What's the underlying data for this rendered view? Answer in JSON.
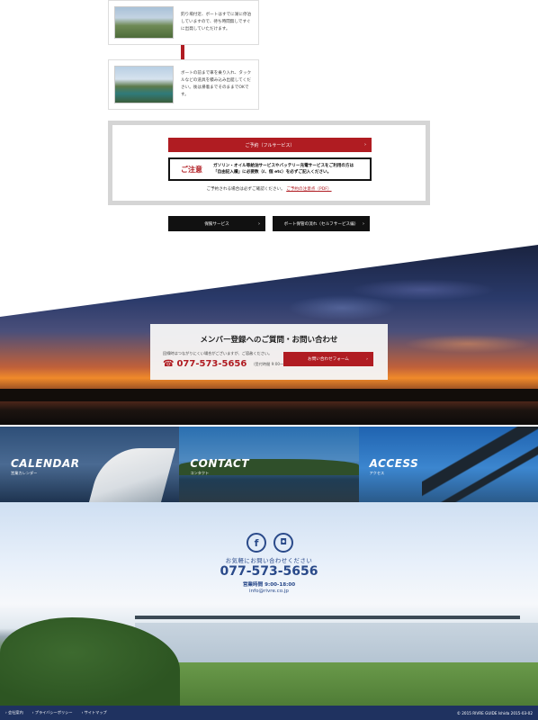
{
  "steps": [
    {
      "text": "釣り場付近、ボートはすでに湖に停泊していますので、待ち時間無しですぐに出発していただけます。"
    },
    {
      "text": "ボートの前まで車を乗り入れ、タックルなどの道具を積み込み出艇してください。後は帰着までそのままでOKです。"
    }
  ],
  "reservation": {
    "button_label": "ご予約（フルサービス）",
    "arrow": "›",
    "notice_label": "ご注意",
    "notice_line1": "ガソリン・オイル等給油サービスやバッテリー充電サービスをご利用の方は",
    "notice_line2": "「自由記入欄」に必要数（ℓ、個 etc）を必ずご記入ください。",
    "confirm_text": "ご予約される場合は必ずご確認ください。",
    "confirm_link": "ご予約の注意点（PDF）"
  },
  "service_buttons": [
    {
      "label": "保険サービス",
      "arrow": "›"
    },
    {
      "label": "ボート保管の流れ（セルフサービス編）",
      "arrow": "›"
    }
  ],
  "contact_card": {
    "title": "メンバー登録へのご質問・お問い合わせ",
    "subtitle": "回線時はつながりにくい場合がございますが、ご容赦ください。",
    "phone": "077-573-5656",
    "hours": "（受付時間 9:00～18:00）",
    "button_label": "お問い合わせフォーム",
    "arrow": "›"
  },
  "panels": [
    {
      "title": "CALENDAR",
      "subtitle": "営業カレンダー"
    },
    {
      "title": "CONTACT",
      "subtitle": "コンタクト"
    },
    {
      "title": "ACCESS",
      "subtitle": "アクセス"
    }
  ],
  "footer_contact": {
    "facebook_glyph": "f",
    "instagram_glyph": "◘",
    "invite": "お気軽にお問い合わせください",
    "phone": "077-573-5656",
    "hours": "営業時間 9:00-18:00",
    "email": "info@rivre.co.jp"
  },
  "footer_bar": {
    "links": [
      "会社案内",
      "プライバシーポリシー",
      "サイトマップ"
    ],
    "copyright": "© 2015 RIVRE GUIDE Ishida 2015-03-02"
  },
  "colors": {
    "accent_red": "#b01c22",
    "navy": "#1f3260",
    "blue_text": "#2a4a8a"
  }
}
